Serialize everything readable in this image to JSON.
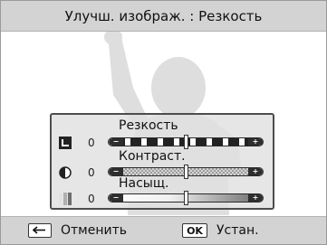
{
  "title": "Улучш. изображ. : Резкость",
  "panel": {
    "sharpness": {
      "label": "Резкость",
      "value": "0",
      "level": 0.5
    },
    "contrast": {
      "label": "Контраст.",
      "value": "0",
      "level": 0.5
    },
    "saturation": {
      "label": "Насыщ.",
      "value": "0",
      "level": 0.5
    }
  },
  "slider_minus": "−",
  "slider_plus": "+",
  "bottom": {
    "cancel_label": "Отменить",
    "ok_key": "OK",
    "set_label": "Устан."
  },
  "colors": {
    "bar_bg": "#d3d3d3",
    "panel_border": "#4d4d4d",
    "silhouette": "#dedede"
  }
}
